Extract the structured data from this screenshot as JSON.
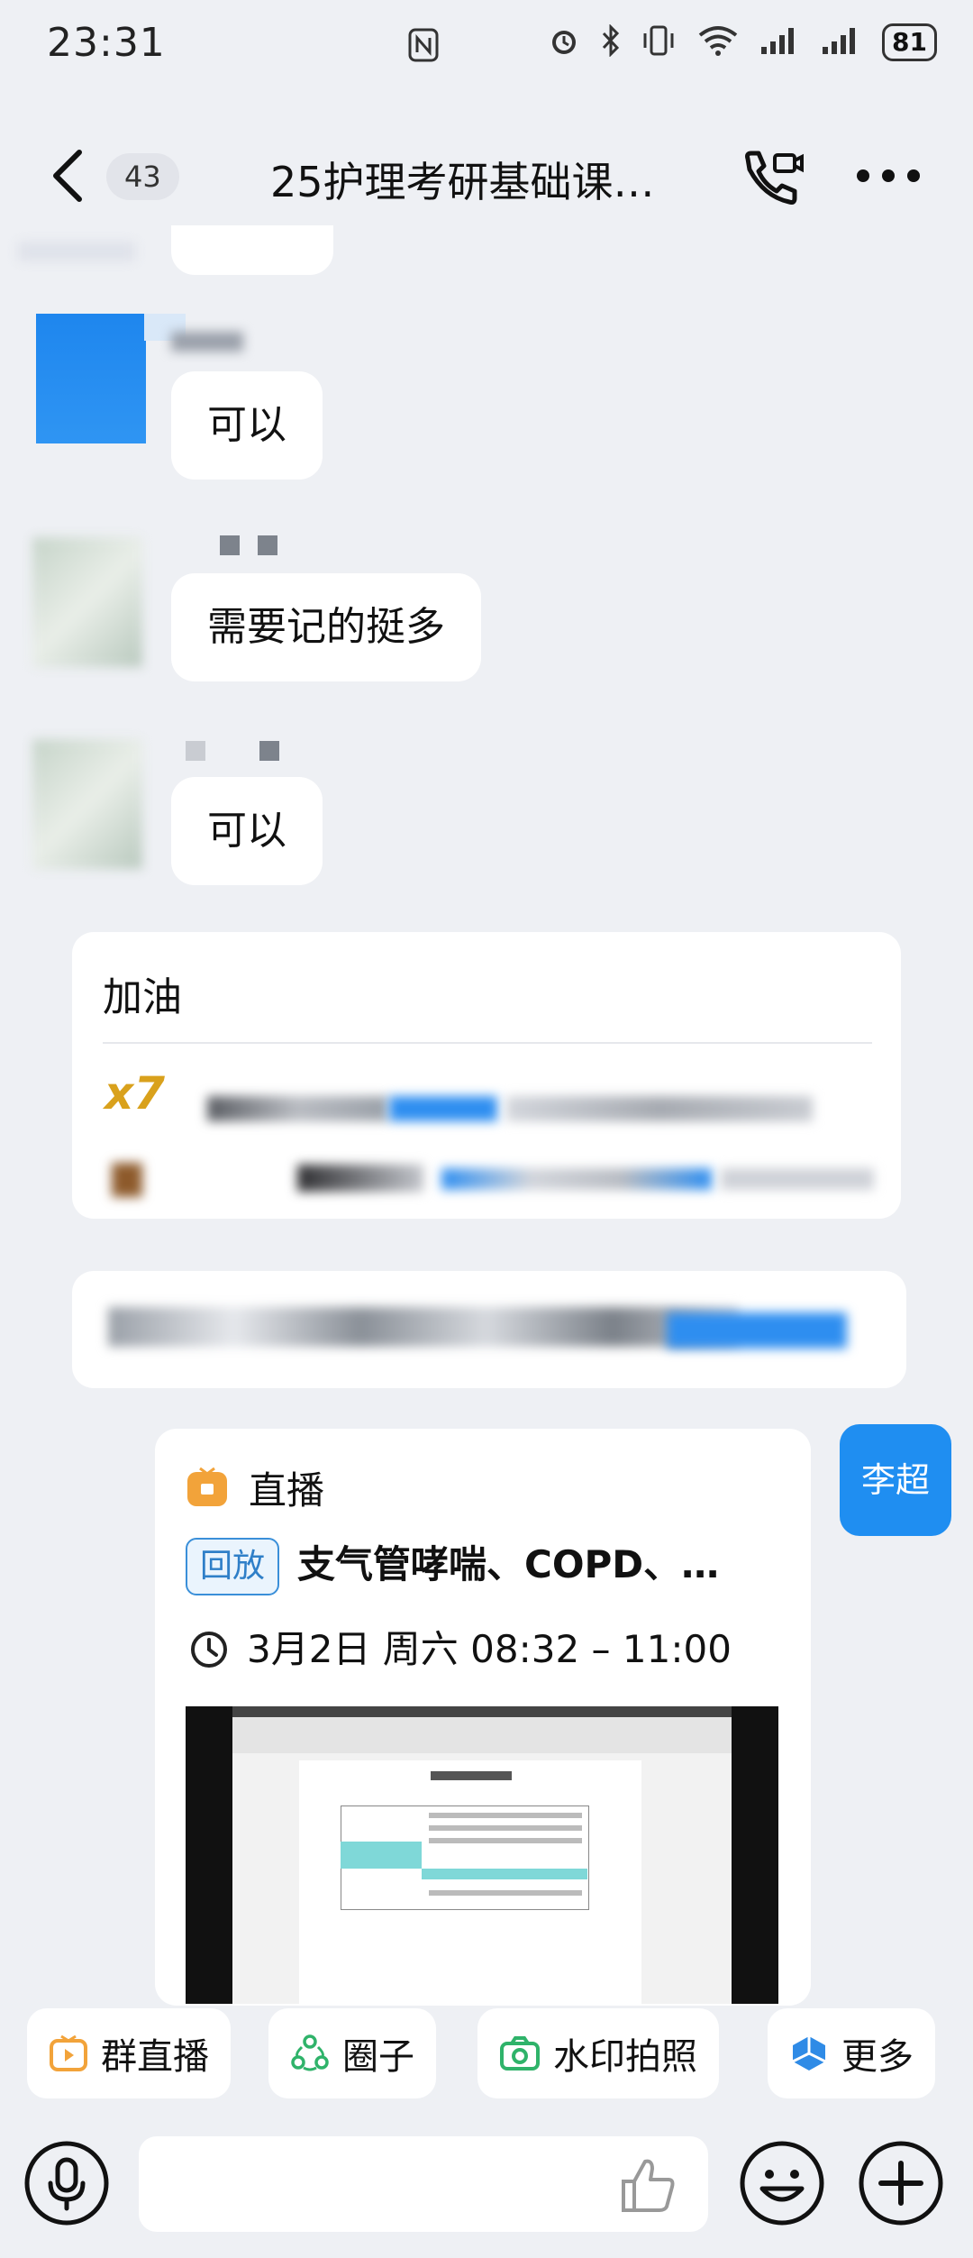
{
  "status_bar": {
    "time": "23:31",
    "battery": "81"
  },
  "header": {
    "unread_count": "43",
    "title": "25护理考研基础课…"
  },
  "messages": [
    {
      "text": "可以"
    },
    {
      "text": "需要记的挺多"
    },
    {
      "text": "可以"
    }
  ],
  "forward_card": {
    "title": "加油"
  },
  "live_card": {
    "type_label": "直播",
    "replay_tag": "回放",
    "title": "支气管哮喘、COPD、…",
    "time": "3月2日 周六 08:32 – 11:00"
  },
  "sender_avatar_label": "李超",
  "quick_actions": [
    {
      "label": "群直播",
      "icon": "tv-icon"
    },
    {
      "label": "圈子",
      "icon": "circle-people-icon"
    },
    {
      "label": "水印拍照",
      "icon": "camera-icon"
    },
    {
      "label": "更多",
      "icon": "cube-icon"
    }
  ],
  "colors": {
    "accent_blue": "#1f8ef1",
    "live_orange": "#f2a33a",
    "background": "#eef0f4"
  }
}
